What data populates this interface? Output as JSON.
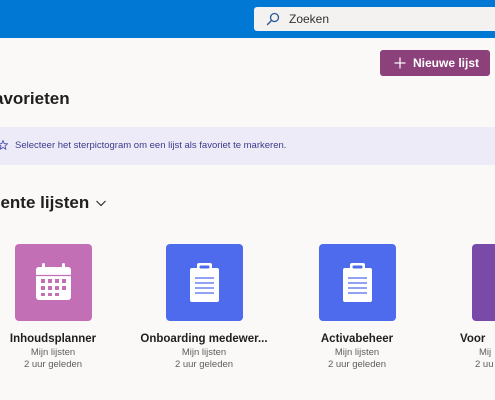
{
  "header": {
    "search_placeholder": "Zoeken"
  },
  "toolbar": {
    "new_list_label": "Nieuwe lijst"
  },
  "favorites": {
    "title": "avorieten",
    "info_text": "Selecteer het sterpictogram om een lijst als favoriet te markeren."
  },
  "recent": {
    "title": "cente lijsten",
    "cards": [
      {
        "title": "Inhoudsplanner",
        "owner": "Mijn lijsten",
        "time": "2 uur geleden",
        "color": "#c36fb5",
        "icon": "calendar-icon"
      },
      {
        "title": "Onboarding medewer...",
        "owner": "Mijn lijsten",
        "time": "2 uur geleden",
        "color": "#4f6bed",
        "icon": "clipboard-icon"
      },
      {
        "title": "Activabeheer",
        "owner": "Mijn lijsten",
        "time": "2 uur geleden",
        "color": "#4f6bed",
        "icon": "clipboard-icon"
      },
      {
        "title": "Voor",
        "owner": "Mij",
        "time": "2 uu",
        "color": "#7a4aa8",
        "icon": "list-icon"
      }
    ]
  },
  "colors": {
    "topbar": "#0078d4",
    "accent_button": "#8c417b",
    "info_bar": "#edebf7"
  }
}
